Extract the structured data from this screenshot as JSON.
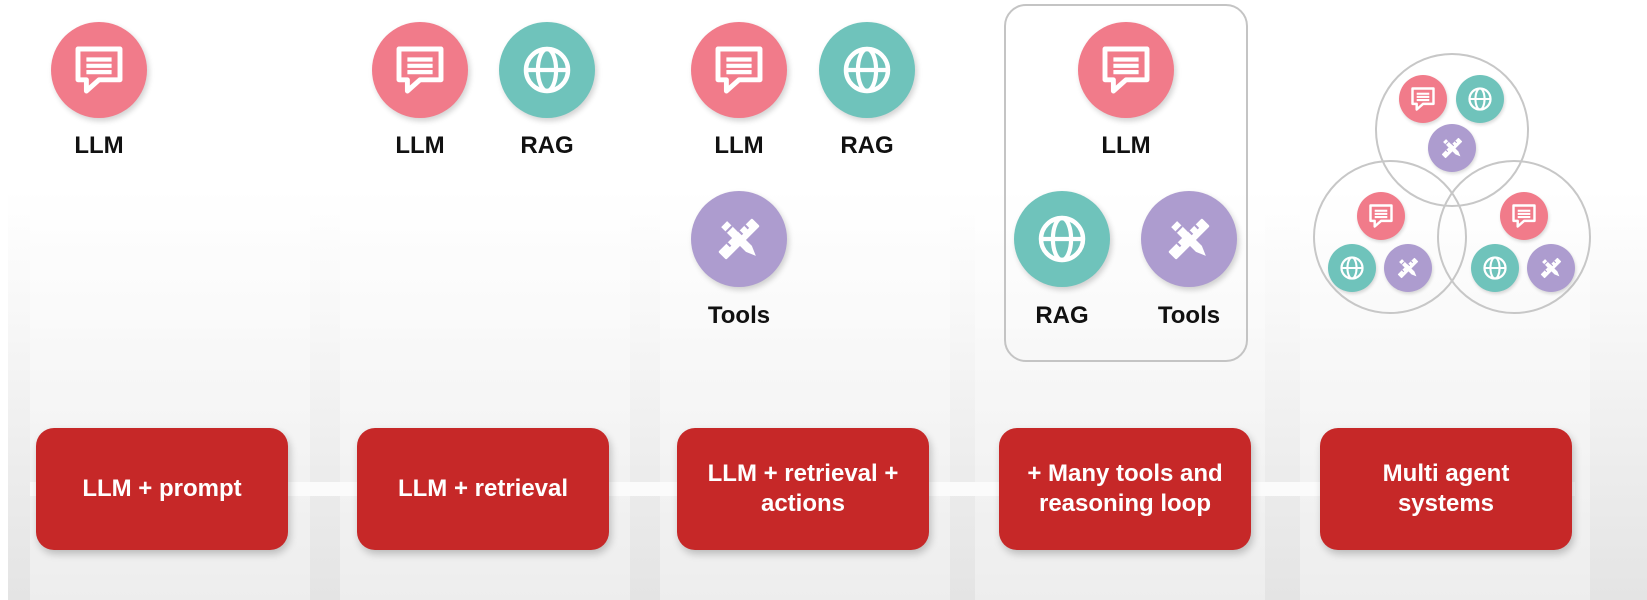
{
  "icon_labels": {
    "llm": "LLM",
    "rag": "RAG",
    "tools": "Tools"
  },
  "icons": {
    "llm": "chat-bubble-icon",
    "rag": "globe-icon",
    "tools": "pencil-ruler-icon"
  },
  "colors": {
    "llm": "#f17b8a",
    "rag": "#6fc3bb",
    "tools": "#ad9ccf",
    "stage": "#c62828"
  },
  "stages": [
    {
      "label": "LLM + prompt"
    },
    {
      "label": "LLM + retrieval"
    },
    {
      "label": "LLM + retrieval + actions"
    },
    {
      "label": "+ Many tools and reasoning loop"
    },
    {
      "label": "Multi agent systems"
    }
  ]
}
